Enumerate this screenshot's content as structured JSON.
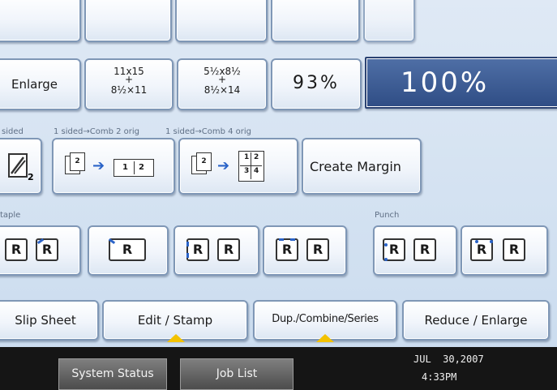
{
  "ratio_buttons": {
    "enlarge": "Enlarge",
    "r1_top": "11x15",
    "r1_mid": "+",
    "r1_bot": "8½×11",
    "r2_top": "5½x8½",
    "r2_mid": "+",
    "r2_bot": "8½×14",
    "percent": "93%",
    "current": "100%"
  },
  "combine": {
    "label_left": "sided",
    "label_mid": "1 sided→Comb 2 orig",
    "label_right": "1 sided→Comb 4 orig",
    "create_margin": "Create Margin"
  },
  "staple_punch": {
    "staple_label": "taple",
    "punch_label": "Punch"
  },
  "tabs": {
    "slip_sheet": "Slip Sheet",
    "edit_stamp": "Edit / Stamp",
    "dup_combine": "Dup./Combine/Series",
    "reduce_enlarge": "Reduce / Enlarge"
  },
  "bottom_bar": {
    "system_status": "System Status",
    "job_list": "Job List",
    "date": "JUL  30,2007",
    "time": "4:33PM"
  },
  "colors": {
    "selected": "#2f4d85",
    "accent_tab": "#f3c200"
  }
}
